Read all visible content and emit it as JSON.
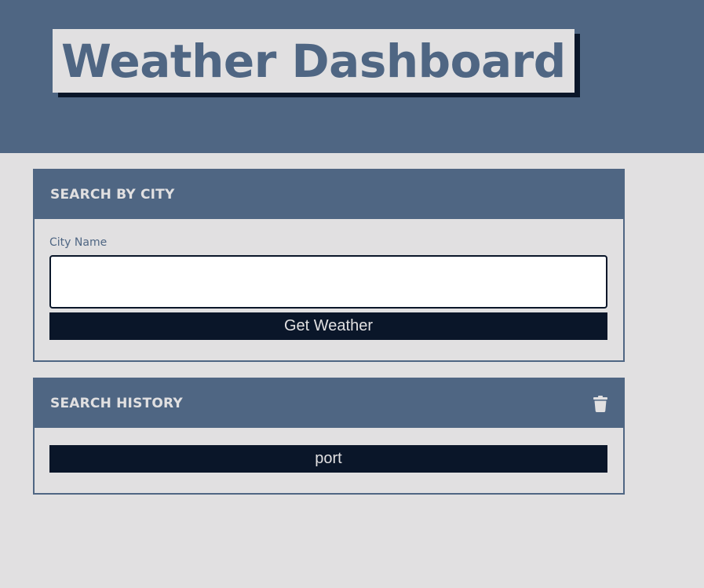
{
  "header": {
    "title": "Weather Dashboard"
  },
  "search": {
    "heading": "SEARCH BY CITY",
    "city_label": "City Name",
    "city_value": "",
    "city_placeholder": "",
    "submit_label": "Get Weather"
  },
  "history": {
    "heading": "SEARCH HISTORY",
    "clear_icon": "trash-icon",
    "items": [
      {
        "label": "port"
      }
    ]
  },
  "colors": {
    "header_bg": "#4f6683",
    "page_bg": "#e1e0e1",
    "button_bg": "#0a1629",
    "text_light": "#e1e0e1"
  }
}
